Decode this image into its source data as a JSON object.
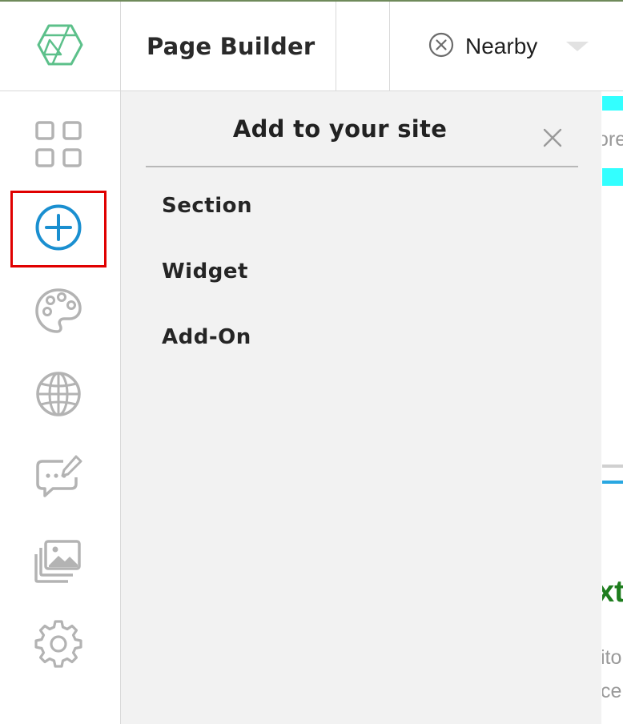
{
  "header": {
    "logo_icon": "hexagon-logo-icon",
    "title": "Page Builder",
    "filter": {
      "icon": "circle-x-icon",
      "label": "Nearby",
      "dropdown_icon": "caret-down-icon"
    }
  },
  "sidebar": {
    "items": [
      {
        "name": "dashboard",
        "icon": "grid-icon",
        "active": false
      },
      {
        "name": "add",
        "icon": "plus-circle-icon",
        "active": true
      },
      {
        "name": "design",
        "icon": "palette-icon",
        "active": false
      },
      {
        "name": "domain",
        "icon": "globe-icon",
        "active": false
      },
      {
        "name": "messages",
        "icon": "chat-edit-icon",
        "active": false
      },
      {
        "name": "media",
        "icon": "images-icon",
        "active": false
      },
      {
        "name": "settings",
        "icon": "gear-icon",
        "active": false
      }
    ]
  },
  "panel": {
    "title": "Add to your site",
    "close_icon": "close-icon",
    "items": [
      {
        "label": "Section"
      },
      {
        "label": "Widget"
      },
      {
        "label": "Add-On"
      }
    ]
  },
  "preview": {
    "fragments": [
      "ore",
      "xt",
      "ito",
      "ce"
    ]
  },
  "colors": {
    "active_icon": "#1a8fd0",
    "inactive_icon": "#b3b3b3",
    "highlight_border": "#e00000",
    "logo": "#5cc08a",
    "panel_bg": "#f2f2f2",
    "preview_cyan": "#33ffff",
    "preview_green": "#1e7d1e"
  }
}
